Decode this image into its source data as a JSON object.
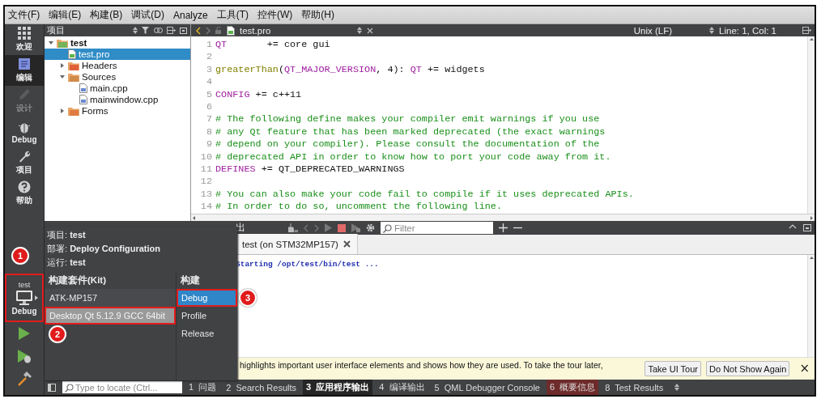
{
  "menu": [
    "文件(F)",
    "编辑(E)",
    "构建(B)",
    "调试(D)",
    "Analyze",
    "工具(T)",
    "控件(W)",
    "帮助(H)"
  ],
  "mode_bar": {
    "items": [
      {
        "kind": "welcome",
        "label": "欢迎",
        "selected": false,
        "disabled": false
      },
      {
        "kind": "edit",
        "label": "编辑",
        "selected": true,
        "disabled": false
      },
      {
        "kind": "design",
        "label": "设计",
        "selected": false,
        "disabled": true
      },
      {
        "kind": "debug",
        "label": "Debug",
        "selected": false,
        "disabled": false
      },
      {
        "kind": "projects",
        "label": "项目",
        "selected": false,
        "disabled": false
      },
      {
        "kind": "help",
        "label": "帮助",
        "selected": false,
        "disabled": false
      }
    ],
    "kit_selector": {
      "project": "test",
      "config": "Debug",
      "annotated": true,
      "marker": "1"
    },
    "actions": [
      {
        "kind": "run"
      },
      {
        "kind": "debug_run"
      },
      {
        "kind": "build"
      }
    ]
  },
  "project_panel": {
    "title": "项目",
    "tree": [
      {
        "label": "test",
        "kind": "project",
        "expanded": true,
        "selected": false,
        "children": [
          {
            "label": "test.pro",
            "kind": "profile",
            "selected": true
          },
          {
            "label": "Headers",
            "kind": "headers",
            "expanded": false,
            "selected": false
          },
          {
            "label": "Sources",
            "kind": "sources",
            "expanded": true,
            "selected": false,
            "children": [
              {
                "label": "main.cpp",
                "kind": "cpp",
                "selected": false
              },
              {
                "label": "mainwindow.cpp",
                "kind": "cpp",
                "selected": false
              }
            ]
          },
          {
            "label": "Forms",
            "kind": "forms",
            "expanded": false,
            "selected": false
          }
        ]
      }
    ]
  },
  "editor": {
    "file": "test.pro",
    "line_ending": "Unix (LF)",
    "position": "Line: 1, Col: 1",
    "lines": [
      {
        "number": "1",
        "segments": [
          {
            "kind": "keyword",
            "text": "QT"
          },
          {
            "kind": "plain",
            "text": "       += core gui"
          }
        ]
      },
      {
        "number": "2"
      },
      {
        "number": "3",
        "segments": [
          {
            "kind": "function",
            "text": "greaterThan"
          },
          {
            "kind": "plain",
            "text": "("
          },
          {
            "kind": "keyword",
            "text": "QT_MAJOR_VERSION"
          },
          {
            "kind": "plain",
            "text": ", 4): "
          },
          {
            "kind": "keyword",
            "text": "QT"
          },
          {
            "kind": "plain",
            "text": " += widgets"
          }
        ]
      },
      {
        "number": "4"
      },
      {
        "number": "5",
        "segments": [
          {
            "kind": "keyword",
            "text": "CONFIG"
          },
          {
            "kind": "plain",
            "text": " += c++11"
          }
        ]
      },
      {
        "number": "6"
      },
      {
        "number": "7",
        "segments": [
          {
            "kind": "comment",
            "text": "# The following define makes your compiler emit warnings if you use"
          }
        ]
      },
      {
        "number": "8",
        "segments": [
          {
            "kind": "comment",
            "text": "# any Qt feature that has been marked deprecated (the exact warnings"
          }
        ]
      },
      {
        "number": "9",
        "segments": [
          {
            "kind": "comment",
            "text": "# depend on your compiler). Please consult the documentation of the"
          }
        ]
      },
      {
        "number": "10",
        "segments": [
          {
            "kind": "comment",
            "text": "# deprecated API in order to know how to port your code away from it."
          }
        ]
      },
      {
        "number": "11",
        "segments": [
          {
            "kind": "keyword",
            "text": "DEFINES"
          },
          {
            "kind": "plain",
            "text": " += QT_DEPRECATED_WARNINGS"
          }
        ]
      },
      {
        "number": "12"
      },
      {
        "number": "13",
        "segments": [
          {
            "kind": "comment",
            "text": "# You can also make your code fail to compile if it uses deprecated APIs."
          }
        ]
      },
      {
        "number": "14",
        "segments": [
          {
            "kind": "comment",
            "text": "# In order to do so, uncomment the following line."
          }
        ]
      }
    ]
  },
  "output_pane": {
    "title": "出",
    "filter": {
      "placeholder": "Filter"
    },
    "tabs": [
      {
        "label": "test (on STM32MP157)",
        "selected": true
      }
    ],
    "text": "Starting /opt/test/bin/test ..."
  },
  "popup": {
    "lines": [
      "项目: **test**",
      "部署: **Deploy Configuration**",
      "运行: **test**"
    ],
    "kit_heading": "构建套件(Kit)",
    "build_heading": "构建",
    "kits": [
      {
        "label": "ATK-MP157",
        "selected": false,
        "annotated": false
      },
      {
        "label": "Desktop Qt 5.12.9 GCC 64bit",
        "selected": true,
        "annotated": true,
        "marker": "2"
      }
    ],
    "builds": [
      {
        "label": "Debug",
        "selected": true,
        "annotated": true,
        "marker": "3"
      },
      {
        "label": "Profile",
        "selected": false,
        "annotated": false
      },
      {
        "label": "Release",
        "selected": false,
        "annotated": false
      }
    ]
  },
  "info_bar": {
    "text": "highlights important user interface elements and shows how they are used. To take the tour later,",
    "buttons": [
      "Take UI Tour",
      "Do Not Show Again"
    ],
    "close": "×"
  },
  "bottom_bar": {
    "locate": {
      "placeholder": "Type to locate (Ctrl..."
    },
    "tabs": [
      {
        "label": "1  问题",
        "selected": false,
        "alert": false
      },
      {
        "label": "2  Search Results",
        "selected": false,
        "alert": false
      },
      {
        "label": "3  应用程序输出",
        "selected": true,
        "alert": false
      },
      {
        "label": "4  编译输出",
        "selected": false,
        "alert": false
      },
      {
        "label": "5  QML Debugger Console",
        "selected": false,
        "alert": false
      },
      {
        "label": "6  概要信息",
        "selected": false,
        "alert": true
      },
      {
        "label": "8  Test Results",
        "selected": false,
        "alert": false
      }
    ]
  }
}
